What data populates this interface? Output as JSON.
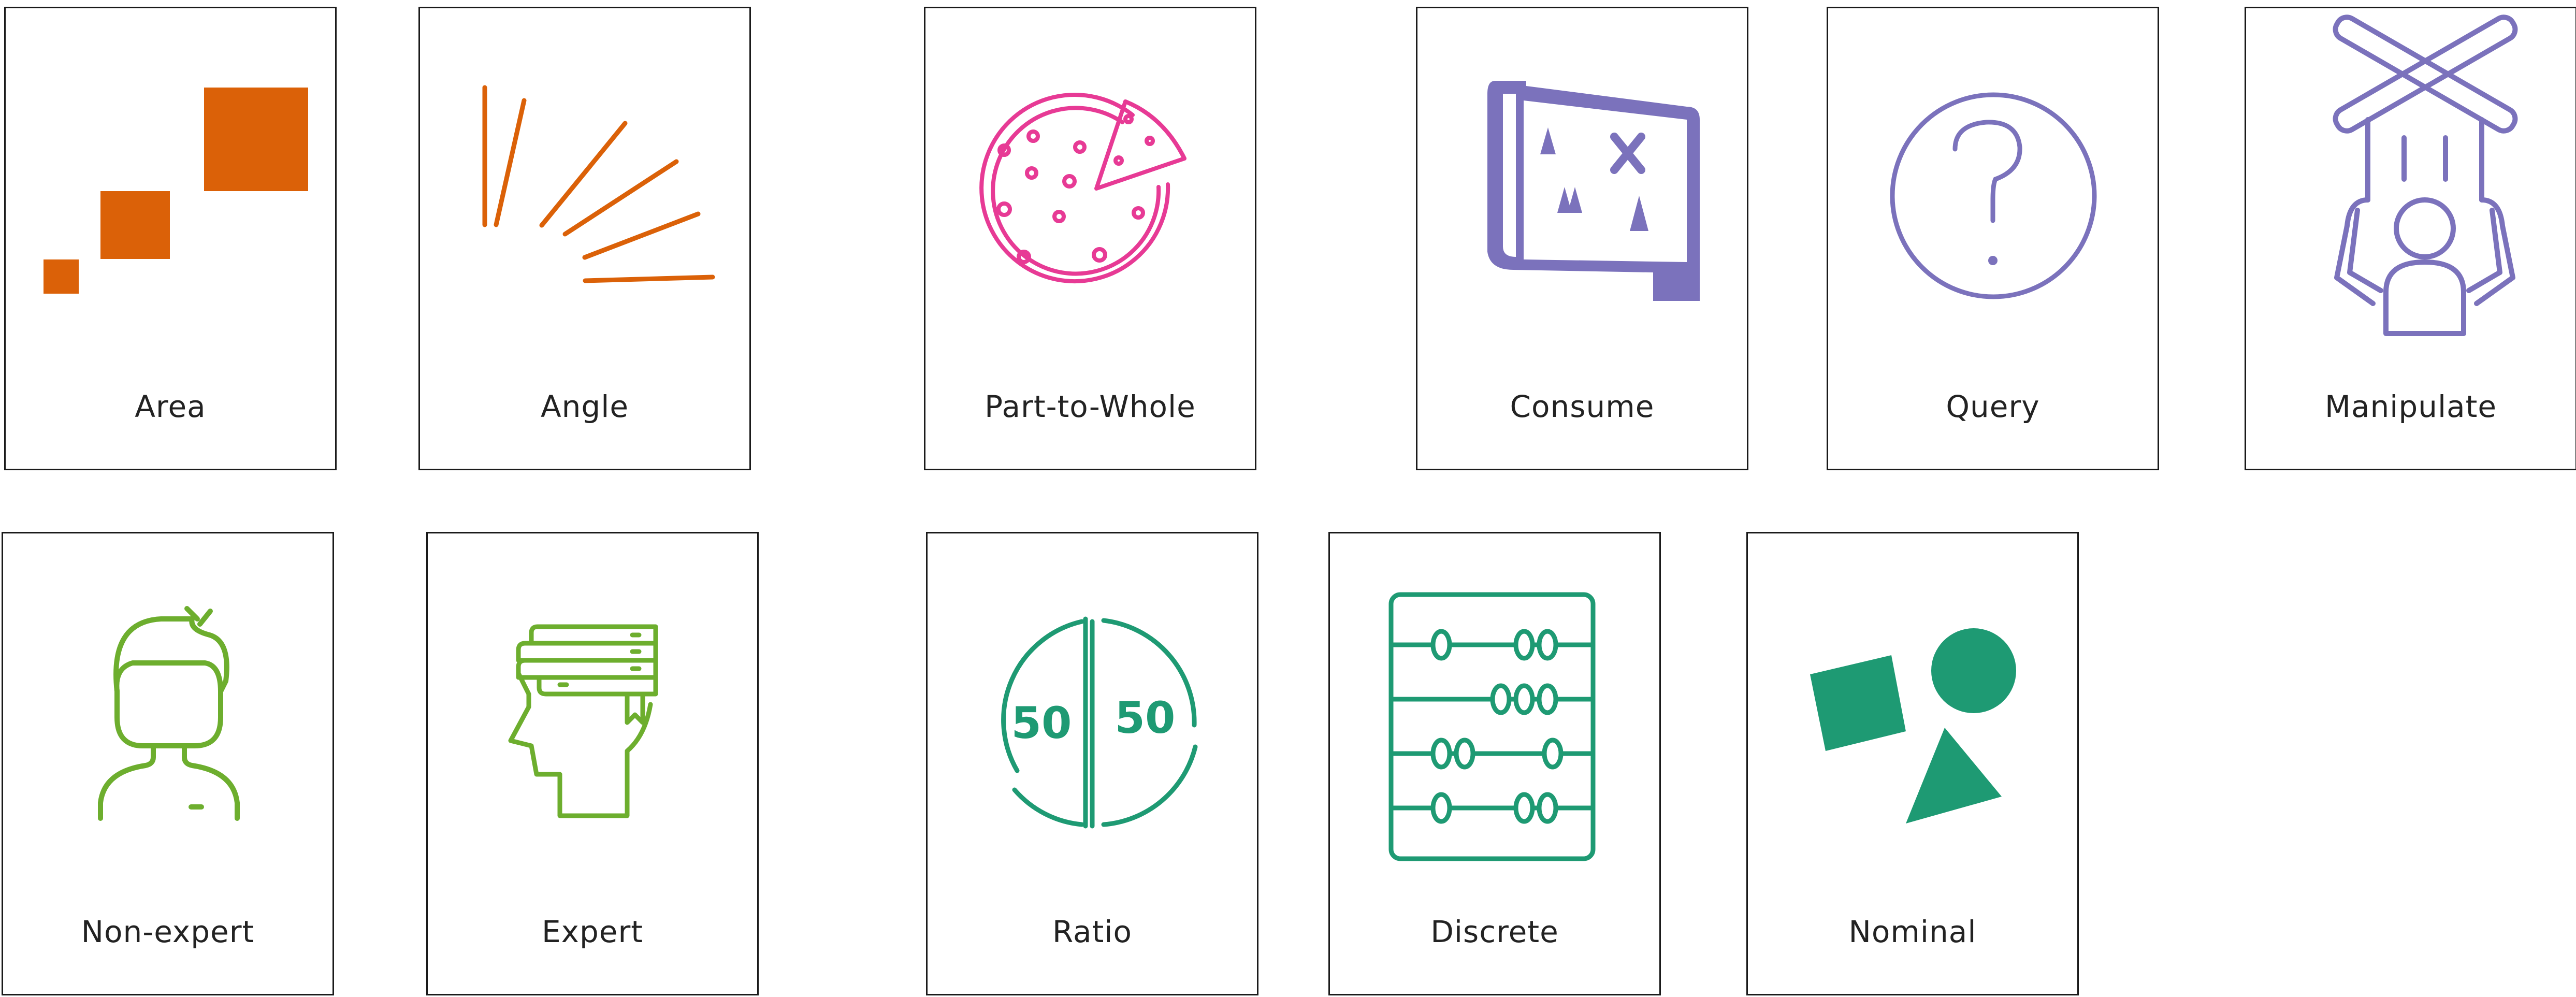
{
  "colors": {
    "orange": "#DB6108",
    "pink": "#E73A95",
    "purple": "#7B72BC",
    "green_light": "#6DAE2E",
    "green_teal": "#1E9A73",
    "border": "#1a1a1a"
  },
  "cards": [
    {
      "label": "Area",
      "icon": "area-squares-icon"
    },
    {
      "label": "Angle",
      "icon": "angle-rays-icon"
    },
    {
      "label": "Part-to-Whole",
      "icon": "pizza-slice-icon"
    },
    {
      "label": "Consume",
      "icon": "treasure-map-icon"
    },
    {
      "label": "Query",
      "icon": "question-circle-icon"
    },
    {
      "label": "Manipulate",
      "icon": "puppet-icon"
    },
    {
      "label": "Non-expert",
      "icon": "person-head-icon"
    },
    {
      "label": "Expert",
      "icon": "head-books-icon"
    },
    {
      "label": "Ratio",
      "icon": "fifty-fifty-icon"
    },
    {
      "label": "Discrete",
      "icon": "abacus-icon"
    },
    {
      "label": "Nominal",
      "icon": "shapes-icon"
    }
  ]
}
